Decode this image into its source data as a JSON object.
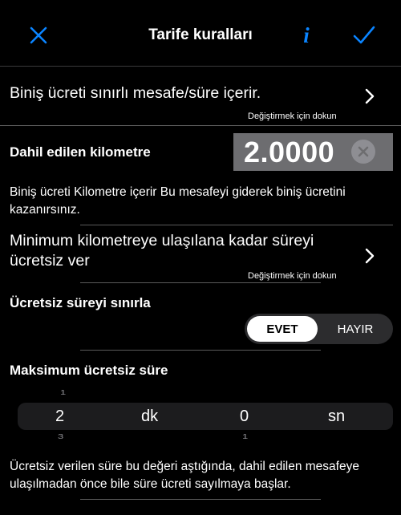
{
  "nav": {
    "title": "Tarife kuralları",
    "info_label": "i",
    "icons": {
      "close": "close-icon",
      "info": "info-icon",
      "done": "checkmark-icon"
    },
    "accent": "#0a84ff"
  },
  "rule": {
    "text": "Biniş ücreti sınırlı mesafe/süre içerir.",
    "hint": "Değiştirmek için dokun"
  },
  "included_km": {
    "label": "Dahil edilen kilometre",
    "value": "2.0000",
    "description": "Biniş ücreti Kilometre içerir Bu mesafeyi giderek biniş ücretini kazanırsınız."
  },
  "free_time": {
    "line1": "Minimum kilometreye ulaşılana kadar süreyi",
    "line2": "ücretsiz ver",
    "hint": "Değiştirmek için dokun"
  },
  "limit_free_time": {
    "label": "Ücretsiz süreyi sınırla",
    "options": [
      "EVET",
      "HAYIR"
    ],
    "selected": "EVET"
  },
  "max_free_time": {
    "label": "Maksimum ücretsiz süre",
    "minutes": "2",
    "minutes_unit": "dk",
    "seconds": "0",
    "seconds_unit": "sn",
    "minutes_prev": "1",
    "minutes_next": "3",
    "seconds_next": "1"
  },
  "footer": {
    "description": "Ücretsiz verilen süre bu değeri aştığında, dahil edilen mesafeye ulaşılmadan önce bile süre ücreti sayılmaya başlar."
  }
}
